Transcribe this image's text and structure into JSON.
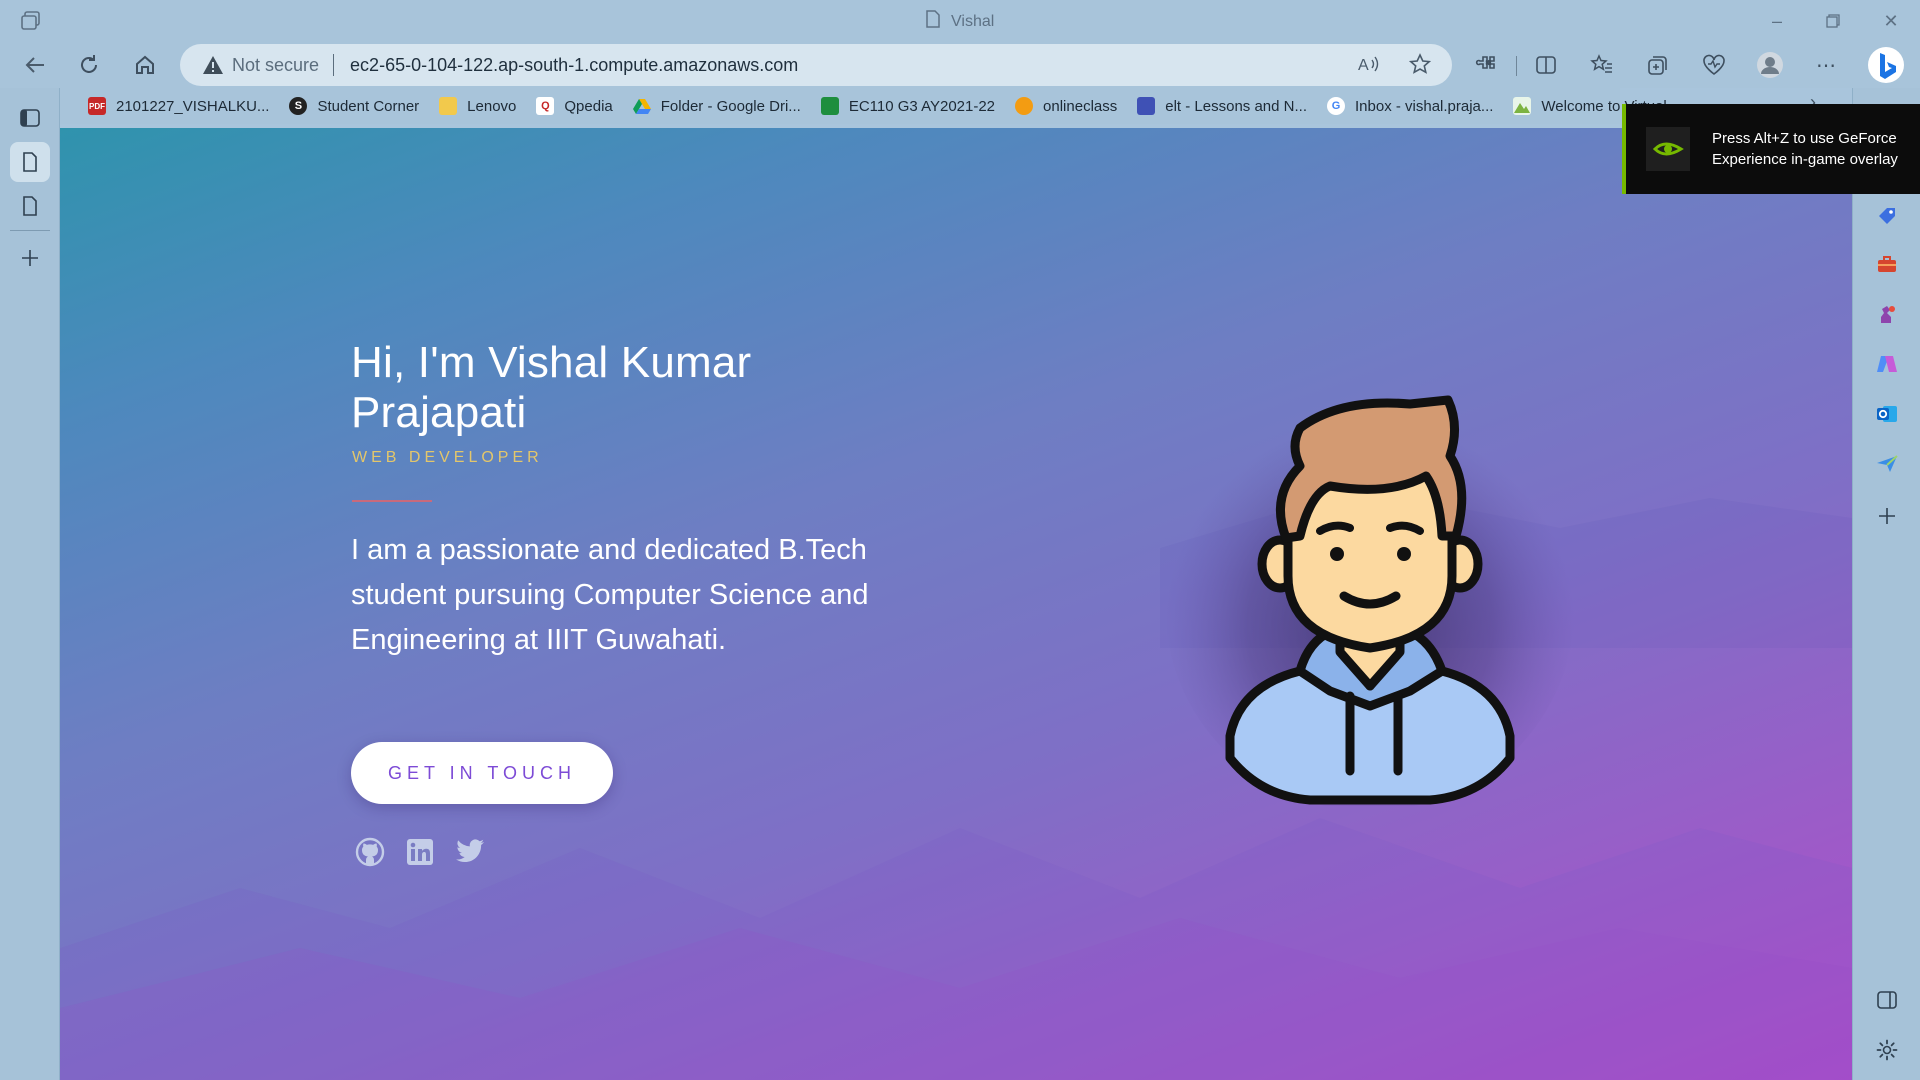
{
  "browser": {
    "tab_title": "Vishal",
    "address": {
      "security_label": "Not secure",
      "url": "ec2-65-0-104-122.ap-south-1.compute.amazonaws.com"
    },
    "favorites": [
      {
        "label": "2101227_VISHALKU...",
        "icon": "pdf-icon",
        "color": "#c62828"
      },
      {
        "label": "Student Corner",
        "icon": "s-logo-icon",
        "color": "#222222"
      },
      {
        "label": "Lenovo",
        "icon": "folder-icon",
        "color": "#f2c94c"
      },
      {
        "label": "Qpedia",
        "icon": "qpedia-icon",
        "color": "#ffffff"
      },
      {
        "label": "Folder - Google Dri...",
        "icon": "google-drive-icon",
        "color": "#1fa463"
      },
      {
        "label": "EC110 G3 AY2021-22",
        "icon": "classroom-icon",
        "color": "#1e8e3e"
      },
      {
        "label": "onlineclass",
        "icon": "sun-icon",
        "color": "#f39c12"
      },
      {
        "label": "elt - Lessons and N...",
        "icon": "forms-icon",
        "color": "#3f51b5"
      },
      {
        "label": "Inbox - vishal.praja...",
        "icon": "google-icon",
        "color": "#4285f4"
      },
      {
        "label": "Welcome to Virtual...",
        "icon": "virtual-icon",
        "color": "#7cb342"
      }
    ]
  },
  "page": {
    "hero_title": "Hi, I'm Vishal Kumar Prajapati",
    "hero_subtitle": "WEB DEVELOPER",
    "hero_description": "I am a passionate and dedicated B.Tech student pursuing Computer Science and Engineering at IIIT Guwahati.",
    "cta_label": "GET IN TOUCH",
    "social": [
      "github-icon",
      "linkedin-icon",
      "twitter-icon"
    ]
  },
  "overlay": {
    "message": "Press Alt+Z to use GeForce Experience in-game overlay"
  },
  "colors": {
    "accent_gold": "#e3c66b",
    "accent_purple": "#7d4bd6",
    "nvidia_green": "#76b900"
  }
}
